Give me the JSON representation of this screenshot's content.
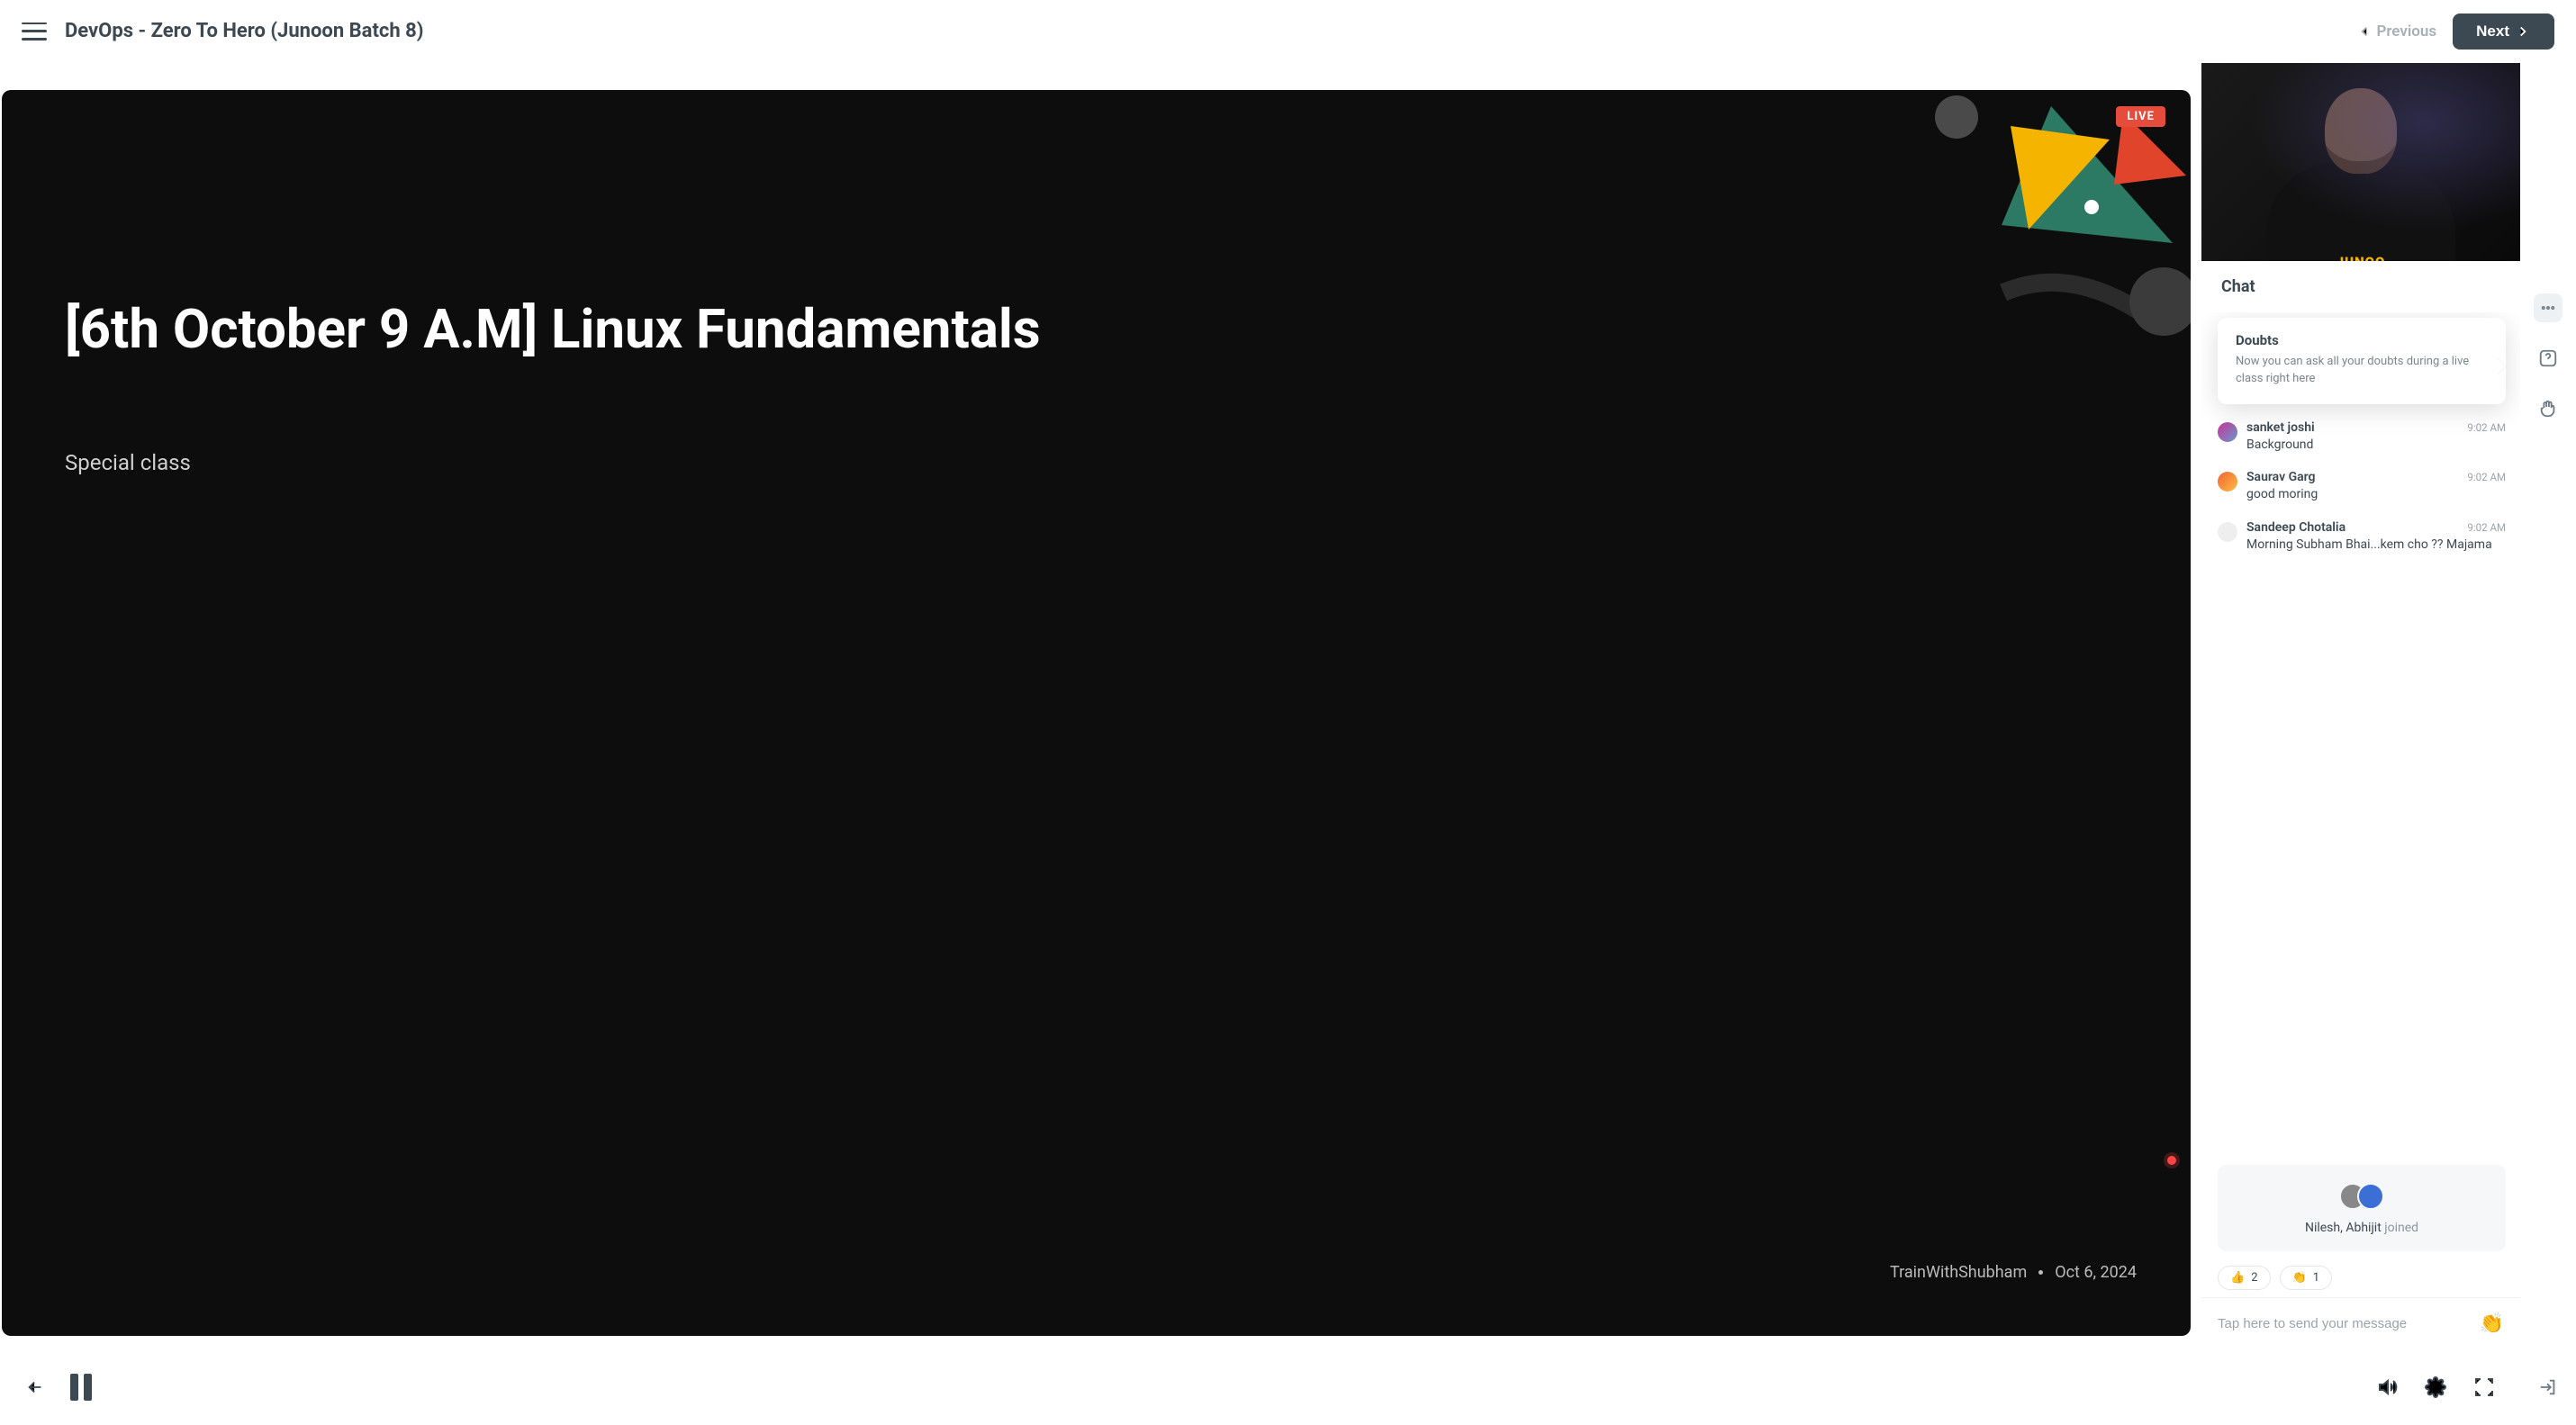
{
  "header": {
    "title": "DevOps - Zero To Hero (Junoon Batch 8)",
    "prev_label": "Previous",
    "next_label": "Next"
  },
  "stage": {
    "live_badge": "LIVE",
    "slide_title": "[6th October 9 A.M] Linux Fundamentals",
    "slide_subtitle": "Special class",
    "instructor": "TrainWithShubham",
    "date": "Oct 6, 2024",
    "presenter_shirt": "JUNOO"
  },
  "chat": {
    "header": "Chat",
    "tooltip": {
      "title": "Doubts",
      "body": "Now you can ask all your doubts during a live class right here"
    },
    "messages": [
      {
        "name": "sanket joshi",
        "time": "9:02 AM",
        "text": "Background"
      },
      {
        "name": "Saurav Garg",
        "time": "9:02 AM",
        "text": "good moring"
      },
      {
        "name": "Sandeep Chotalia",
        "time": "9:02 AM",
        "text": "Morning Subham Bhai...kem cho ?? Majama"
      }
    ],
    "joined": {
      "names": "Nilesh, Abhijit",
      "suffix": " joined"
    },
    "reactions": [
      {
        "emoji": "👍",
        "count": "2"
      },
      {
        "emoji": "👏",
        "count": "1"
      }
    ],
    "input_placeholder": "Tap here to send your message",
    "clap_emoji": "👏"
  }
}
